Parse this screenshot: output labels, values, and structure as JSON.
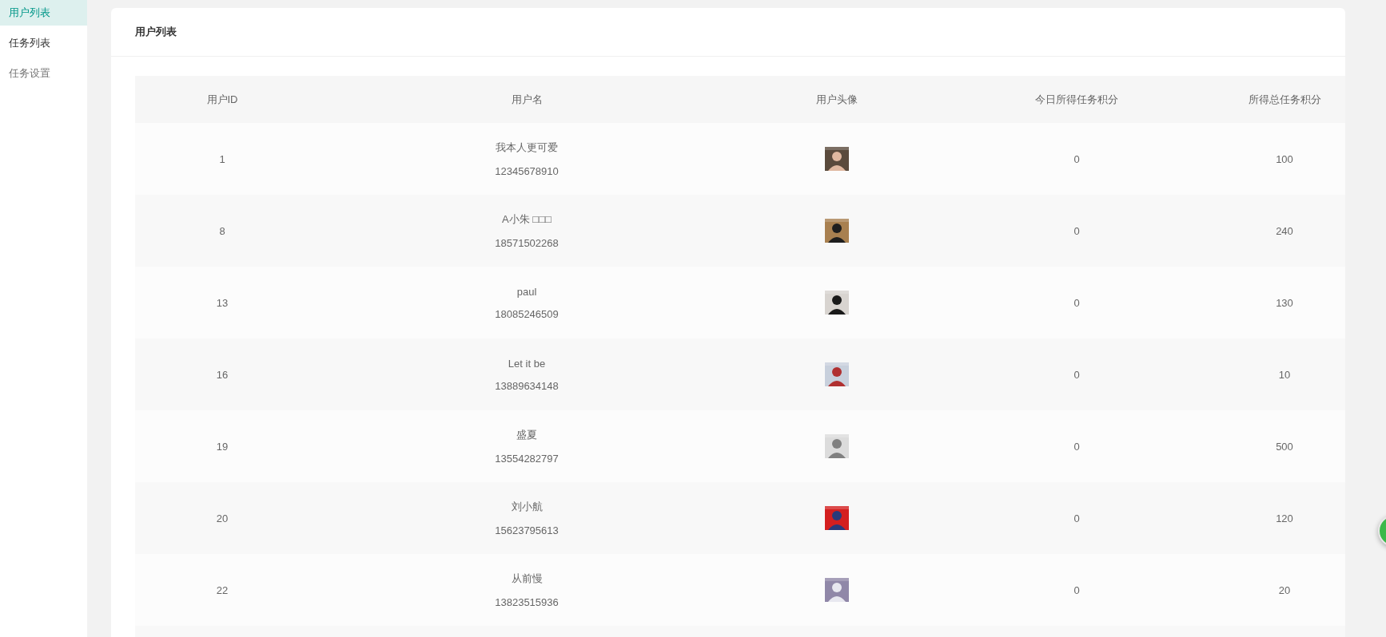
{
  "sidebar": {
    "items": [
      {
        "label": "用户列表",
        "selected": true
      },
      {
        "label": "任务列表",
        "selected": false
      },
      {
        "label": "任务设置",
        "selected": false
      }
    ]
  },
  "card": {
    "title": "用户列表"
  },
  "table": {
    "columns": [
      "用户ID",
      "用户名",
      "用户头像",
      "今日所得任务积分",
      "所得总任务积分"
    ],
    "rows": [
      {
        "id": "1",
        "name": "我本人更可爱",
        "phone": "12345678910",
        "today": "0",
        "total": "100"
      },
      {
        "id": "8",
        "name": "A小朱 □□□",
        "phone": "18571502268",
        "today": "0",
        "total": "240"
      },
      {
        "id": "13",
        "name": "paul",
        "phone": "18085246509",
        "today": "0",
        "total": "130"
      },
      {
        "id": "16",
        "name": "Let it be",
        "phone": "13889634148",
        "today": "0",
        "total": "10"
      },
      {
        "id": "19",
        "name": "盛夏",
        "phone": "13554282797",
        "today": "0",
        "total": "500"
      },
      {
        "id": "20",
        "name": "刘小航",
        "phone": "15623795613",
        "today": "0",
        "total": "120"
      },
      {
        "id": "22",
        "name": "从前慢",
        "phone": "13823515936",
        "today": "0",
        "total": "20"
      }
    ]
  }
}
